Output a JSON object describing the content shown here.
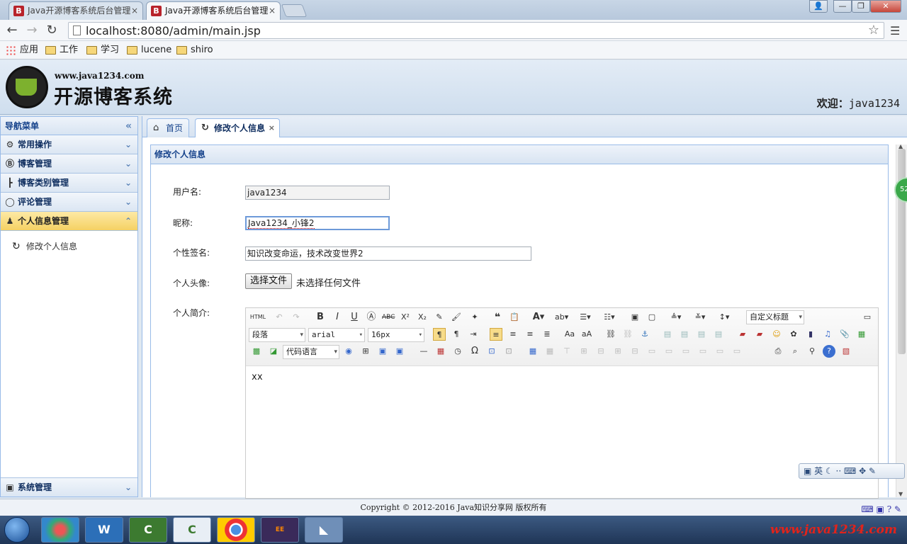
{
  "browser": {
    "tabs": [
      {
        "label": "Java开源博客系统后台管理",
        "favicon": "B"
      },
      {
        "label": "Java开源博客系统后台管理",
        "favicon": "B"
      }
    ],
    "url": "localhost:8080/admin/main.jsp",
    "bookmarks": [
      "应用",
      "工作",
      "学习",
      "lucene",
      "shiro"
    ]
  },
  "header": {
    "site_url": "www.java1234.com",
    "site_title": "开源博客系统",
    "welcome_label": "欢迎：",
    "username": "java1234"
  },
  "sidebar": {
    "title": "导航菜单",
    "items": [
      {
        "label": "常用操作",
        "icon": "gear-icon"
      },
      {
        "label": "博客管理",
        "icon": "blog-icon"
      },
      {
        "label": "博客类别管理",
        "icon": "tree-icon"
      },
      {
        "label": "评论管理",
        "icon": "comment-icon"
      },
      {
        "label": "个人信息管理",
        "icon": "user-icon"
      }
    ],
    "active_links": [
      "修改个人信息"
    ],
    "bottom_item": {
      "label": "系统管理",
      "icon": "system-icon"
    }
  },
  "main": {
    "tabs": [
      {
        "label": "首页",
        "icon": "home-icon"
      },
      {
        "label": "修改个人信息",
        "icon": "refresh-icon"
      }
    ],
    "panel_title": "修改个人信息",
    "form": {
      "username_label": "用户名:",
      "username_value": "java1234",
      "nickname_label": "昵称:",
      "nickname_value": "Java1234_小锋2",
      "sign_label": "个性签名:",
      "sign_value": "知识改变命运，技术改变世界2",
      "avatar_label": "个人头像:",
      "file_button": "选择文件",
      "file_status": "未选择任何文件",
      "intro_label": "个人简介:"
    },
    "editor": {
      "html_btn": "HTML",
      "paragraph": "段落",
      "font": "arial",
      "size": "16px",
      "heading": "自定义标题",
      "code_lang": "代码语言",
      "content": "xx"
    }
  },
  "float_badge": "52",
  "ime": {
    "label": "英"
  },
  "footer": {
    "text": "Copyright © 2012-2016 Java知识分享网 版权所有"
  },
  "taskbar": {
    "watermark": "www.java1234.com"
  }
}
